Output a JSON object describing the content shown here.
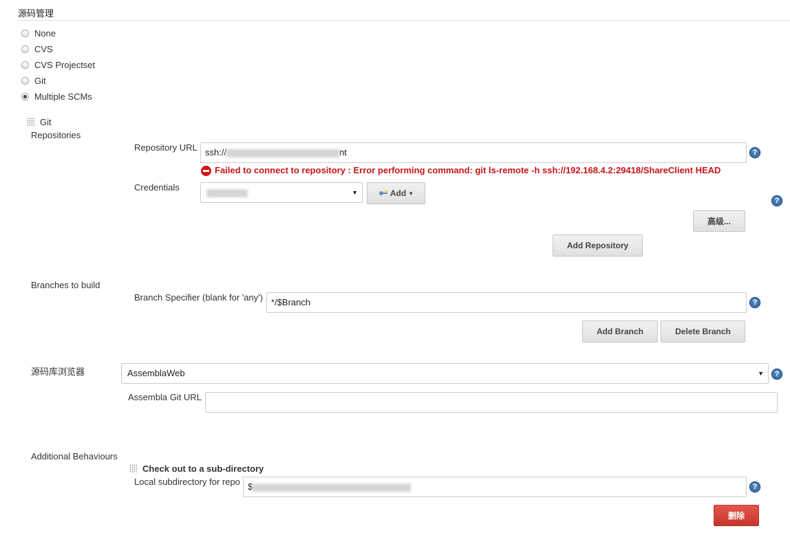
{
  "section": {
    "title": "源码管理"
  },
  "scm_options": [
    {
      "label": "None",
      "checked": false
    },
    {
      "label": "CVS",
      "checked": false
    },
    {
      "label": "CVS Projectset",
      "checked": false
    },
    {
      "label": "Git",
      "checked": false
    },
    {
      "label": "Multiple SCMs",
      "checked": true
    }
  ],
  "git": {
    "header": "Git",
    "repositories_label": "Repositories",
    "repo_url_label": "Repository URL",
    "repo_url_prefix": "ssh://",
    "repo_url_suffix": "nt",
    "error_message": "Failed to connect to repository : Error performing command: git ls-remote -h ssh://192.168.4.2:29418/ShareClient HEAD",
    "credentials_label": "Credentials",
    "add_label": "Add",
    "advanced_label": "高级...",
    "add_repository_label": "Add Repository",
    "branches_label": "Branches to build",
    "branch_specifier_label": "Branch Specifier (blank for 'any')",
    "branch_specifier_value": "*/$Branch",
    "add_branch_label": "Add Branch",
    "delete_branch_label": "Delete Branch",
    "repo_browser_label": "源码库浏览器",
    "repo_browser_value": "AssemblaWeb",
    "assembla_url_label": "Assembla Git URL",
    "assembla_url_value": "",
    "additional_behaviours_label": "Additional Behaviours",
    "checkout_subdir_title": "Check out to a sub-directory",
    "local_subdir_label": "Local subdirectory for repo",
    "local_subdir_prefix": "$",
    "delete_label": "删除"
  },
  "icons": {
    "help": "help-icon",
    "error": "error-icon",
    "key": "key-icon",
    "grip": "drag-handle-icon"
  },
  "colors": {
    "error_red": "#c8141a",
    "delete_button": "#d04437",
    "help_blue": "#2b5f99"
  }
}
